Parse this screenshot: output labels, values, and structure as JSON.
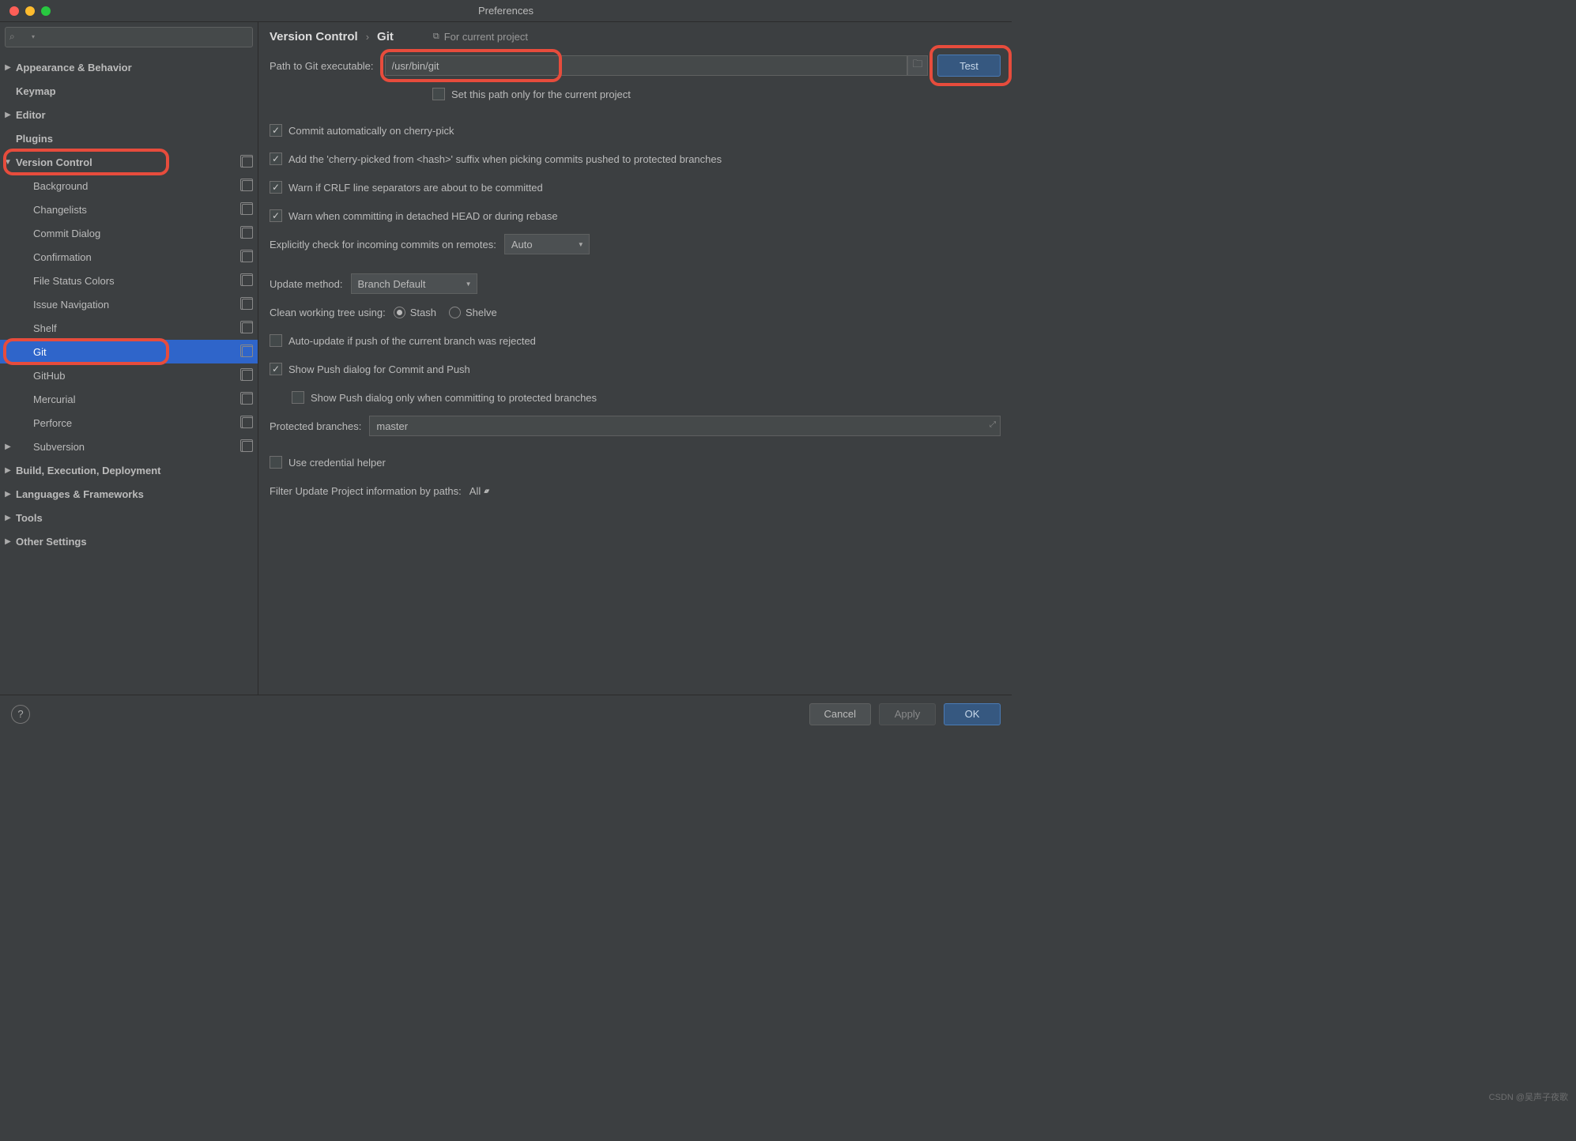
{
  "window": {
    "title": "Preferences"
  },
  "sidebar": {
    "search_placeholder": "",
    "items": [
      {
        "label": "Appearance & Behavior",
        "arrow": "▶",
        "bold": true
      },
      {
        "label": "Keymap",
        "arrow": "",
        "bold": true
      },
      {
        "label": "Editor",
        "arrow": "▶",
        "bold": true
      },
      {
        "label": "Plugins",
        "arrow": "",
        "bold": true
      },
      {
        "label": "Version Control",
        "arrow": "▼",
        "bold": true,
        "copy": true,
        "hl": true
      },
      {
        "label": "Background",
        "sub": true,
        "copy": true
      },
      {
        "label": "Changelists",
        "sub": true,
        "copy": true
      },
      {
        "label": "Commit Dialog",
        "sub": true,
        "copy": true
      },
      {
        "label": "Confirmation",
        "sub": true,
        "copy": true
      },
      {
        "label": "File Status Colors",
        "sub": true,
        "copy": true
      },
      {
        "label": "Issue Navigation",
        "sub": true,
        "copy": true
      },
      {
        "label": "Shelf",
        "sub": true,
        "copy": true
      },
      {
        "label": "Git",
        "sub": true,
        "copy": true,
        "sel": true,
        "hl": true
      },
      {
        "label": "GitHub",
        "sub": true,
        "copy": true
      },
      {
        "label": "Mercurial",
        "sub": true,
        "copy": true
      },
      {
        "label": "Perforce",
        "sub": true,
        "copy": true
      },
      {
        "label": "Subversion",
        "arrow": "▶",
        "sub": true,
        "bold": true,
        "copy": true
      },
      {
        "label": "Build, Execution, Deployment",
        "arrow": "▶",
        "bold": true
      },
      {
        "label": "Languages & Frameworks",
        "arrow": "▶",
        "bold": true
      },
      {
        "label": "Tools",
        "arrow": "▶",
        "bold": true
      },
      {
        "label": "Other Settings",
        "arrow": "▶",
        "bold": true
      }
    ]
  },
  "crumb": {
    "c1": "Version Control",
    "c2": "Git",
    "proj": "For current project"
  },
  "form": {
    "path_label": "Path to Git executable:",
    "path_value": "/usr/bin/git",
    "test": "Test",
    "set_path_only": "Set this path only for the current project",
    "commit_auto": "Commit automatically on cherry-pick",
    "add_suffix": "Add the 'cherry-picked from <hash>' suffix when picking commits pushed to protected branches",
    "warn_crlf": "Warn if CRLF line separators are about to be committed",
    "warn_detached": "Warn when committing in detached HEAD or during rebase",
    "explicit_label": "Explicitly check for incoming commits on remotes:",
    "explicit_value": "Auto",
    "update_label": "Update method:",
    "update_value": "Branch Default",
    "clean_label": "Clean working tree using:",
    "clean_stash": "Stash",
    "clean_shelve": "Shelve",
    "auto_update": "Auto-update if push of the current branch was rejected",
    "show_push": "Show Push dialog for Commit and Push",
    "show_push_protected": "Show Push dialog only when committing to protected branches",
    "protected_label": "Protected branches:",
    "protected_value": "master",
    "cred_helper": "Use credential helper",
    "filter_label": "Filter Update Project information by paths:",
    "filter_value": "All"
  },
  "footer": {
    "cancel": "Cancel",
    "apply": "Apply",
    "ok": "OK"
  },
  "watermark": "CSDN @吴声子夜歌"
}
